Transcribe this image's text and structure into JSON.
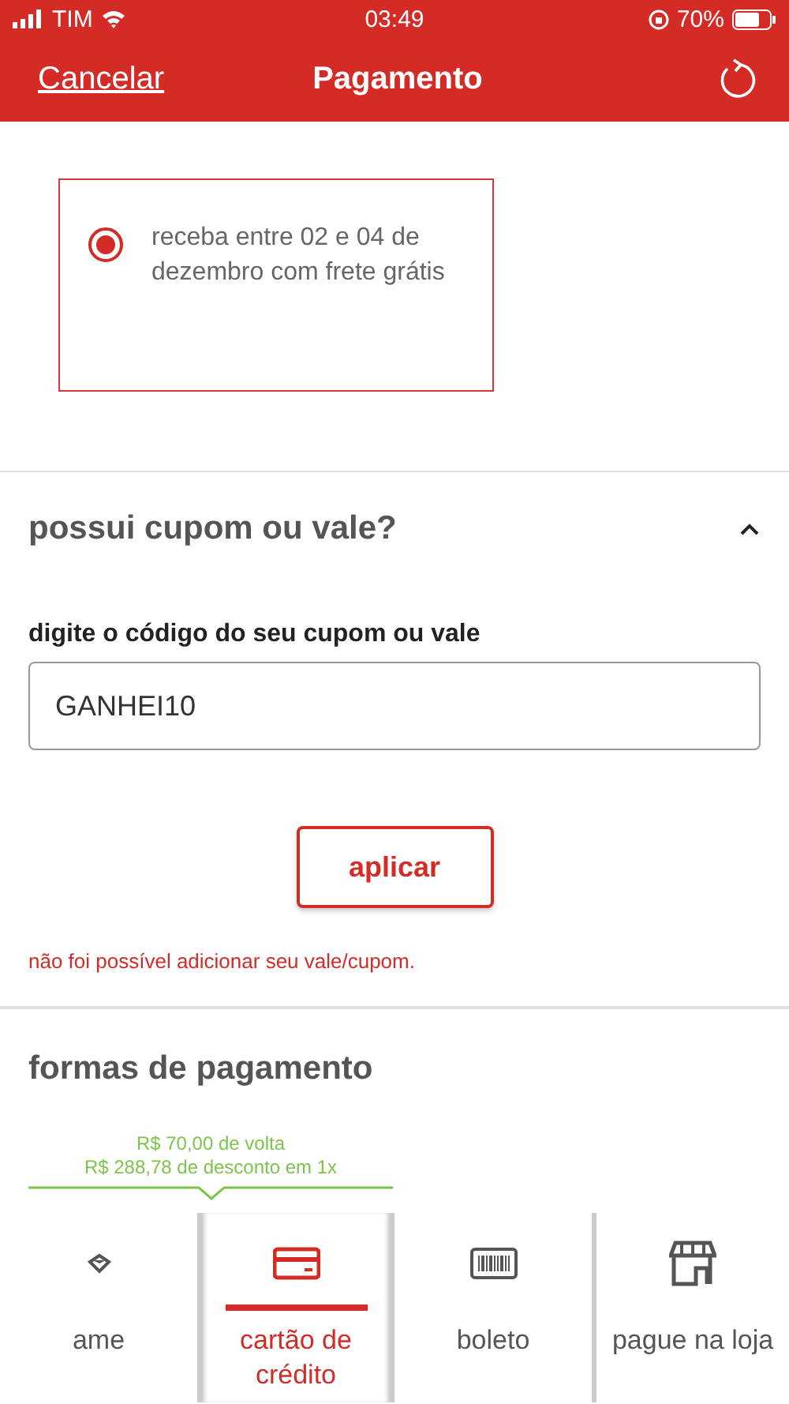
{
  "status_bar": {
    "carrier": "TIM",
    "time": "03:49",
    "battery": "70%"
  },
  "nav_bar": {
    "cancel": "Cancelar",
    "title": "Pagamento"
  },
  "shipping_option": {
    "text": "receba entre 02 e 04 de dezembro com frete grátis",
    "selected": true
  },
  "coupon": {
    "title": "possui cupom ou vale?",
    "expanded": true,
    "label": "digite o código do seu cupom ou vale",
    "value": "GANHEI10",
    "button": "aplicar",
    "error": "não foi possível adicionar seu vale/cupom."
  },
  "payment": {
    "title": "formas de pagamento",
    "promo_lines": [
      "R$ 70,00  de volta",
      "R$ 288,78 de desconto em 1x"
    ],
    "tabs": [
      {
        "label": "ame",
        "kind": "ame",
        "selected": false
      },
      {
        "label": "cartão de crédito",
        "kind": "card",
        "selected": true
      },
      {
        "label": "boleto",
        "kind": "barcode",
        "selected": false
      },
      {
        "label": "pague na loja",
        "kind": "store",
        "selected": false
      }
    ]
  }
}
